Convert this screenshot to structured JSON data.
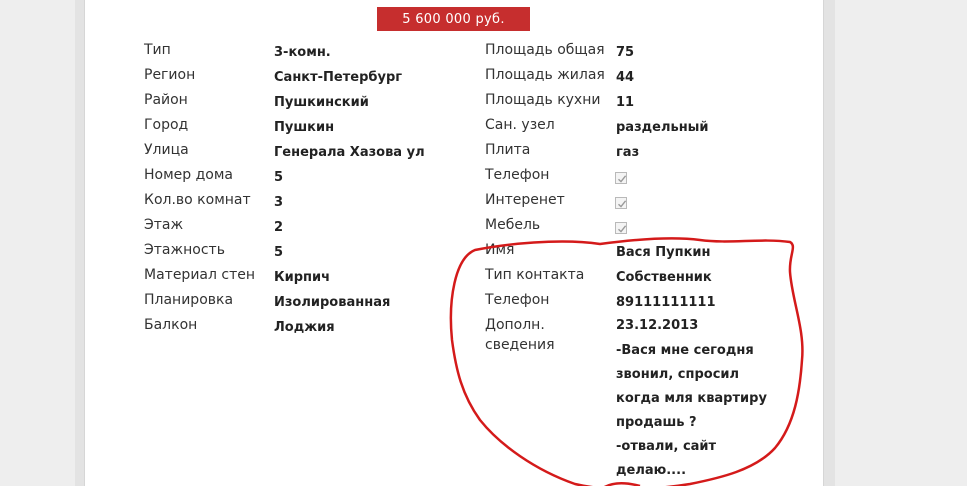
{
  "price": "5 600 000 руб.",
  "left_fields": [
    {
      "label": "Тип",
      "value": "3-комн."
    },
    {
      "label": "Регион",
      "value": "Санкт-Петербург"
    },
    {
      "label": "Район",
      "value": "Пушкинский"
    },
    {
      "label": "Город",
      "value": "Пушкин"
    },
    {
      "label": "Улица",
      "value": "Генерала Хазова ул"
    },
    {
      "label": "Номер дома",
      "value": "5"
    },
    {
      "label": "Кол.во комнат",
      "value": "3"
    },
    {
      "label": "Этаж",
      "value": "2"
    },
    {
      "label": "Этажность",
      "value": "5"
    },
    {
      "label": "Материал стен",
      "value": "Кирпич"
    },
    {
      "label": "Планировка",
      "value": "Изолированная"
    },
    {
      "label": "Балкон",
      "value": "Лоджия"
    }
  ],
  "right_fields": [
    {
      "label": "Площадь общая",
      "value": "75"
    },
    {
      "label": "Площадь жилая",
      "value": "44"
    },
    {
      "label": "Площадь кухни",
      "value": "11"
    },
    {
      "label": "Сан. узел",
      "value": "раздельный"
    },
    {
      "label": "Плита",
      "value": "газ"
    }
  ],
  "amenities": [
    {
      "label": "Телефон",
      "checked": true
    },
    {
      "label": "Интеренет",
      "checked": true
    },
    {
      "label": "Мебель",
      "checked": true
    }
  ],
  "contact": {
    "name_label": "Имя",
    "name_value": "Вася Пупкин",
    "type_label": "Тип контакта",
    "type_value": "Собственник",
    "phone_label": "Телефон",
    "phone_value": "89111111111",
    "extra_label_1": "Дополн.",
    "extra_label_2": "сведения",
    "extra_lines": [
      "23.12.2013",
      "-Вася мне сегодня",
      "звонил, спросил",
      "когда мля квартиру",
      "продашь ?",
      "-отвали, сайт",
      "делаю...."
    ]
  },
  "colors": {
    "price_bg": "#c62e2e",
    "annotation": "#d41a1a"
  }
}
